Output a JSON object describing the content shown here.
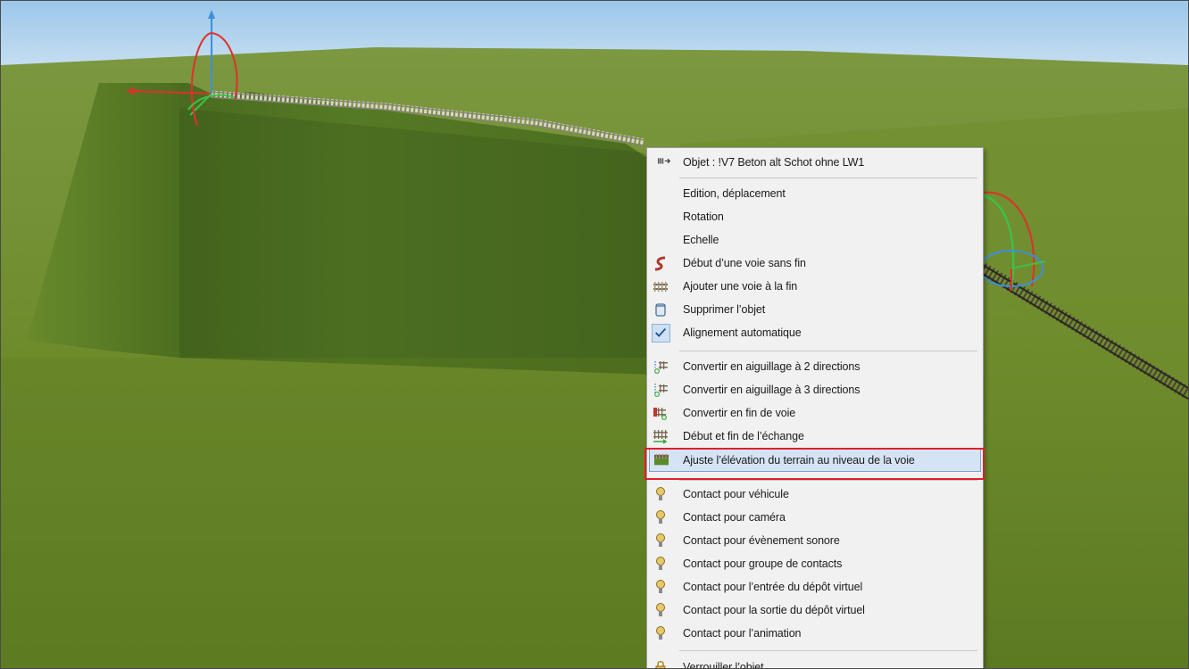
{
  "scene": {
    "sky_color": "#a7cde9",
    "grass_color": "#6b8a2c"
  },
  "context_menu": {
    "header": {
      "label": "Objet : !V7 Beton alt Schot ohne LW1",
      "icon": "track-object-icon"
    },
    "items": [
      {
        "label": "Edition, déplacement",
        "icon": ""
      },
      {
        "label": "Rotation",
        "icon": ""
      },
      {
        "label": "Echelle",
        "icon": ""
      },
      {
        "label": "Début d’une voie sans fin",
        "icon": "endless-track-icon"
      },
      {
        "label": "Ajouter une voie à la fin",
        "icon": "add-track-icon"
      },
      {
        "label": "Supprimer l’objet",
        "icon": "trash-icon"
      },
      {
        "label": "Alignement automatique",
        "icon": "checkmark-icon",
        "checked": true
      },
      {
        "label": "Convertir en aiguillage à 2 directions",
        "icon": "switch-2-icon"
      },
      {
        "label": "Convertir en aiguillage à 3 directions",
        "icon": "switch-3-icon"
      },
      {
        "label": "Convertir en fin de voie",
        "icon": "track-end-icon"
      },
      {
        "label": "Début et fin de l’échange",
        "icon": "exchange-icon"
      },
      {
        "label": "Ajuste l’élévation du terrain au niveau de la voie",
        "icon": "terrain-icon",
        "highlighted": true
      },
      {
        "label": "Contact pour véhicule",
        "icon": "contact-icon"
      },
      {
        "label": "Contact pour caméra",
        "icon": "contact-icon"
      },
      {
        "label": "Contact pour évènement sonore",
        "icon": "contact-icon"
      },
      {
        "label": "Contact pour groupe de contacts",
        "icon": "contact-icon"
      },
      {
        "label": "Contact pour l’entrée du dépôt virtuel",
        "icon": "contact-icon"
      },
      {
        "label": "Contact pour la sortie du dépôt virtuel",
        "icon": "contact-icon"
      },
      {
        "label": "Contact pour l’animation",
        "icon": "contact-icon"
      },
      {
        "label": "Verrouiller l’objet",
        "icon": "lock-icon"
      }
    ],
    "highlight_color": "#d5e4f5",
    "annotation_color": "#e0202a"
  }
}
